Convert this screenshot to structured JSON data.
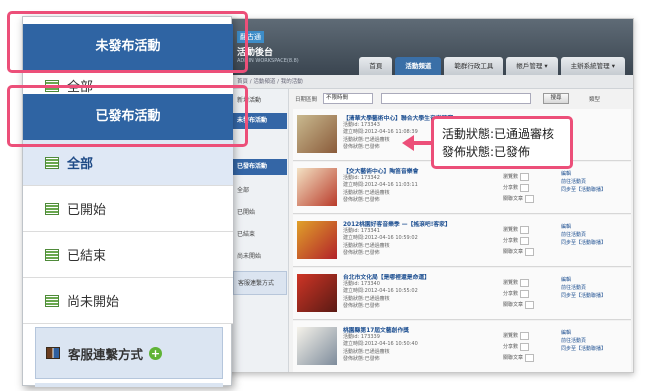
{
  "app": {
    "logo_badge": "翻古通",
    "title": "活動後台",
    "subtitle": "ADMIN WORKSPACE(8.8)",
    "nav_tabs": [
      "首頁",
      "活動頻道",
      "範群行政工具",
      "帳戶管理 ▾",
      "主辦系統管理 ▾"
    ],
    "breadcrumb": "首頁 / 活動頻道 / 我的活動",
    "sidebar": [
      "新增活動",
      "未發布活動",
      "已發布活動",
      "全部",
      "已開始",
      "已結束",
      "尚未開始",
      "客服連繫方式"
    ],
    "toolbar": {
      "label": "日期區間",
      "select_value": "不限時間",
      "search_button": "搜尋",
      "sort_label": "類型"
    },
    "rows": [
      {
        "title": "【清華大學藝術中心】聯合大學生音樂競賽",
        "id": "活動id: 173343",
        "created": "建立時間:2012-04-16 11:08:39",
        "status": "活動狀態:已通過審核",
        "publish": "發佈狀態:已發佈",
        "stats": [
          "瀏覽數",
          "分享數",
          "關聯文章"
        ]
      },
      {
        "title": "【交大藝術中心】陶笛音樂會",
        "id": "活動id: 173342",
        "created": "建立時間:2012-04-16 11:03:11",
        "status": "活動狀態:已通過審核",
        "publish": "發佈狀態:已發佈",
        "stats": [
          "瀏覽數",
          "分享數",
          "關聯文章"
        ]
      },
      {
        "title": "2012桃園好客音樂季 —【搖滾吧!客家】",
        "id": "活動id: 173341",
        "created": "建立時間:2012-04-16 10:59:02",
        "status": "活動狀態:已通過審核",
        "publish": "發佈狀態:已發佈",
        "stats": [
          "瀏覽數",
          "分享數",
          "關聯文章"
        ]
      },
      {
        "title": "台北市文化局【是哪裡還是命運】",
        "id": "活動id: 173340",
        "created": "建立時間:2012-04-16 10:55:02",
        "status": "活動狀態:已通過審核",
        "publish": "發佈狀態:已發佈",
        "stats": [
          "瀏覽數",
          "分享數",
          "關聯文章"
        ]
      },
      {
        "title": "桃園縣第17屆文藝創作獎",
        "id": "活動id: 173339",
        "created": "建立時間:2012-04-16 10:50:40",
        "status": "活動狀態:已通過審核",
        "publish": "發佈狀態:已發佈",
        "stats": [
          "瀏覽數",
          "分享數",
          "關聯文章"
        ]
      }
    ],
    "row_actions": [
      "編輯",
      "前往活動頁",
      "同步至【活動聯播】"
    ]
  },
  "overlay": {
    "unpublished_header": "未發布活動",
    "all_top": "全部",
    "published_header": "已發布活動",
    "items": [
      "全部",
      "已開始",
      "已結束",
      "尚未開始"
    ],
    "contact": "客服連繫方式"
  },
  "callout": {
    "line1": "活動狀態:已通過審核",
    "line2": "發佈狀態:已發佈"
  },
  "colors": {
    "highlight": "#ec4f79",
    "header_blue": "#2f64a3",
    "contact_bg": "#dbe5f2"
  }
}
